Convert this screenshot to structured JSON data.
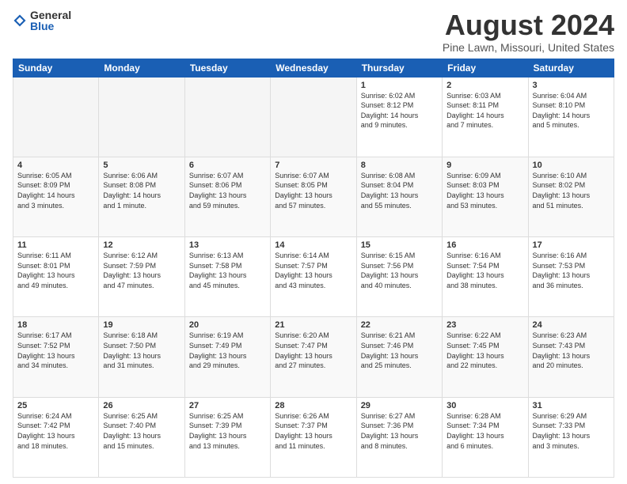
{
  "logo": {
    "general": "General",
    "blue": "Blue"
  },
  "title": "August 2024",
  "subtitle": "Pine Lawn, Missouri, United States",
  "days_of_week": [
    "Sunday",
    "Monday",
    "Tuesday",
    "Wednesday",
    "Thursday",
    "Friday",
    "Saturday"
  ],
  "weeks": [
    [
      {
        "day": "",
        "info": ""
      },
      {
        "day": "",
        "info": ""
      },
      {
        "day": "",
        "info": ""
      },
      {
        "day": "",
        "info": ""
      },
      {
        "day": "1",
        "info": "Sunrise: 6:02 AM\nSunset: 8:12 PM\nDaylight: 14 hours\nand 9 minutes."
      },
      {
        "day": "2",
        "info": "Sunrise: 6:03 AM\nSunset: 8:11 PM\nDaylight: 14 hours\nand 7 minutes."
      },
      {
        "day": "3",
        "info": "Sunrise: 6:04 AM\nSunset: 8:10 PM\nDaylight: 14 hours\nand 5 minutes."
      }
    ],
    [
      {
        "day": "4",
        "info": "Sunrise: 6:05 AM\nSunset: 8:09 PM\nDaylight: 14 hours\nand 3 minutes."
      },
      {
        "day": "5",
        "info": "Sunrise: 6:06 AM\nSunset: 8:08 PM\nDaylight: 14 hours\nand 1 minute."
      },
      {
        "day": "6",
        "info": "Sunrise: 6:07 AM\nSunset: 8:06 PM\nDaylight: 13 hours\nand 59 minutes."
      },
      {
        "day": "7",
        "info": "Sunrise: 6:07 AM\nSunset: 8:05 PM\nDaylight: 13 hours\nand 57 minutes."
      },
      {
        "day": "8",
        "info": "Sunrise: 6:08 AM\nSunset: 8:04 PM\nDaylight: 13 hours\nand 55 minutes."
      },
      {
        "day": "9",
        "info": "Sunrise: 6:09 AM\nSunset: 8:03 PM\nDaylight: 13 hours\nand 53 minutes."
      },
      {
        "day": "10",
        "info": "Sunrise: 6:10 AM\nSunset: 8:02 PM\nDaylight: 13 hours\nand 51 minutes."
      }
    ],
    [
      {
        "day": "11",
        "info": "Sunrise: 6:11 AM\nSunset: 8:01 PM\nDaylight: 13 hours\nand 49 minutes."
      },
      {
        "day": "12",
        "info": "Sunrise: 6:12 AM\nSunset: 7:59 PM\nDaylight: 13 hours\nand 47 minutes."
      },
      {
        "day": "13",
        "info": "Sunrise: 6:13 AM\nSunset: 7:58 PM\nDaylight: 13 hours\nand 45 minutes."
      },
      {
        "day": "14",
        "info": "Sunrise: 6:14 AM\nSunset: 7:57 PM\nDaylight: 13 hours\nand 43 minutes."
      },
      {
        "day": "15",
        "info": "Sunrise: 6:15 AM\nSunset: 7:56 PM\nDaylight: 13 hours\nand 40 minutes."
      },
      {
        "day": "16",
        "info": "Sunrise: 6:16 AM\nSunset: 7:54 PM\nDaylight: 13 hours\nand 38 minutes."
      },
      {
        "day": "17",
        "info": "Sunrise: 6:16 AM\nSunset: 7:53 PM\nDaylight: 13 hours\nand 36 minutes."
      }
    ],
    [
      {
        "day": "18",
        "info": "Sunrise: 6:17 AM\nSunset: 7:52 PM\nDaylight: 13 hours\nand 34 minutes."
      },
      {
        "day": "19",
        "info": "Sunrise: 6:18 AM\nSunset: 7:50 PM\nDaylight: 13 hours\nand 31 minutes."
      },
      {
        "day": "20",
        "info": "Sunrise: 6:19 AM\nSunset: 7:49 PM\nDaylight: 13 hours\nand 29 minutes."
      },
      {
        "day": "21",
        "info": "Sunrise: 6:20 AM\nSunset: 7:47 PM\nDaylight: 13 hours\nand 27 minutes."
      },
      {
        "day": "22",
        "info": "Sunrise: 6:21 AM\nSunset: 7:46 PM\nDaylight: 13 hours\nand 25 minutes."
      },
      {
        "day": "23",
        "info": "Sunrise: 6:22 AM\nSunset: 7:45 PM\nDaylight: 13 hours\nand 22 minutes."
      },
      {
        "day": "24",
        "info": "Sunrise: 6:23 AM\nSunset: 7:43 PM\nDaylight: 13 hours\nand 20 minutes."
      }
    ],
    [
      {
        "day": "25",
        "info": "Sunrise: 6:24 AM\nSunset: 7:42 PM\nDaylight: 13 hours\nand 18 minutes."
      },
      {
        "day": "26",
        "info": "Sunrise: 6:25 AM\nSunset: 7:40 PM\nDaylight: 13 hours\nand 15 minutes."
      },
      {
        "day": "27",
        "info": "Sunrise: 6:25 AM\nSunset: 7:39 PM\nDaylight: 13 hours\nand 13 minutes."
      },
      {
        "day": "28",
        "info": "Sunrise: 6:26 AM\nSunset: 7:37 PM\nDaylight: 13 hours\nand 11 minutes."
      },
      {
        "day": "29",
        "info": "Sunrise: 6:27 AM\nSunset: 7:36 PM\nDaylight: 13 hours\nand 8 minutes."
      },
      {
        "day": "30",
        "info": "Sunrise: 6:28 AM\nSunset: 7:34 PM\nDaylight: 13 hours\nand 6 minutes."
      },
      {
        "day": "31",
        "info": "Sunrise: 6:29 AM\nSunset: 7:33 PM\nDaylight: 13 hours\nand 3 minutes."
      }
    ]
  ]
}
